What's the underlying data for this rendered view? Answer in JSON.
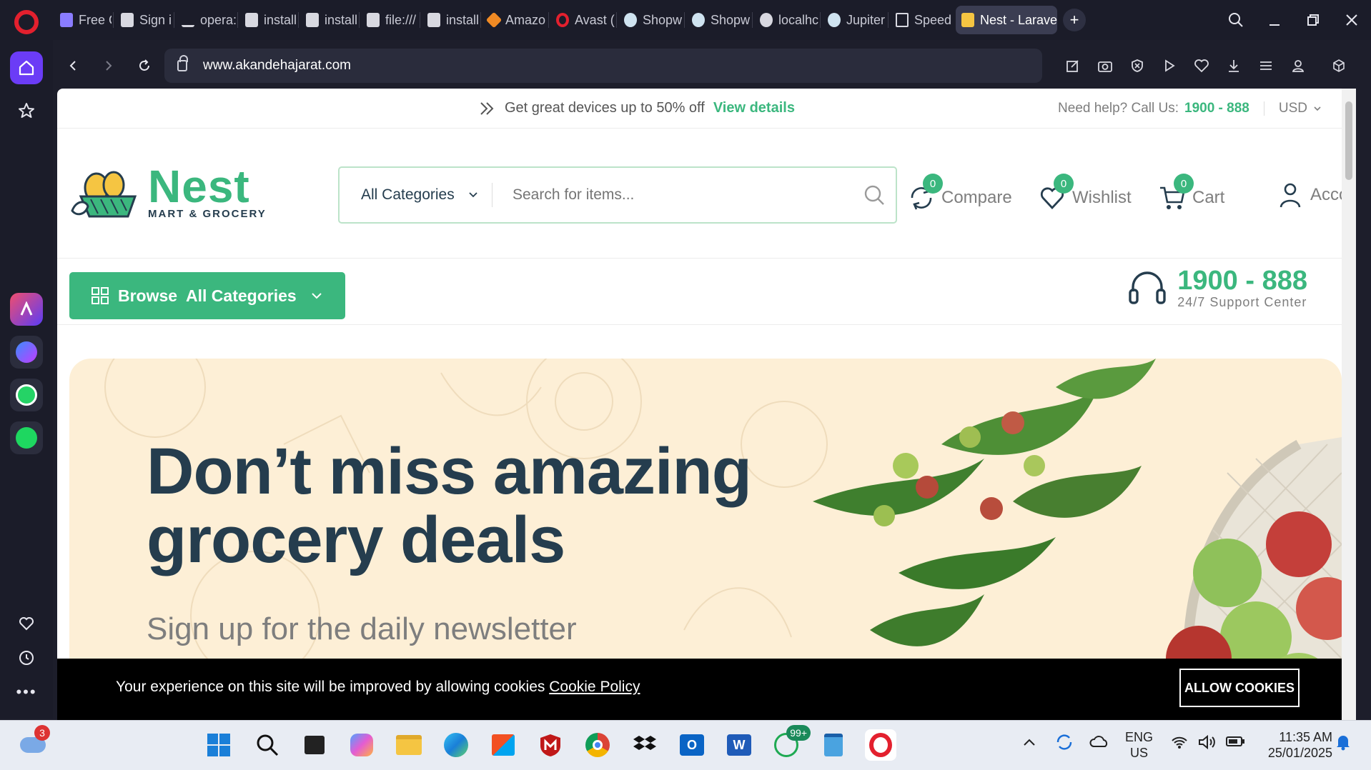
{
  "browser": {
    "tabs": [
      {
        "label": "Free Cl",
        "icon": "cube-icon"
      },
      {
        "label": "Sign in",
        "icon": "file-icon"
      },
      {
        "label": "opera:/",
        "icon": "download-icon"
      },
      {
        "label": "install",
        "icon": "file-icon"
      },
      {
        "label": "install",
        "icon": "file-icon"
      },
      {
        "label": "file:///",
        "icon": "file-icon"
      },
      {
        "label": "install",
        "icon": "file-icon"
      },
      {
        "label": "Amazo",
        "icon": "aws-icon"
      },
      {
        "label": "Avast (",
        "icon": "opera-icon"
      },
      {
        "label": "Shopw",
        "icon": "shop-icon"
      },
      {
        "label": "Shopw",
        "icon": "shop-icon"
      },
      {
        "label": "localhc",
        "icon": "globe-icon"
      },
      {
        "label": "Jupiter",
        "icon": "shop-icon"
      },
      {
        "label": "Speed",
        "icon": "grid-icon"
      },
      {
        "label": "Nest - Larave",
        "icon": "nest-icon"
      }
    ],
    "url": "www.akandehajarat.com"
  },
  "site": {
    "topbar": {
      "promo_text": "Get great devices up to 50% off",
      "promo_link": "View details",
      "help_text": "Need help? Call Us:",
      "help_phone": "1900 - 888",
      "currency": "USD"
    },
    "logo": {
      "name": "Nest",
      "tagline": "MART & GROCERY"
    },
    "search": {
      "category": "All Categories",
      "placeholder": "Search for items..."
    },
    "actions": {
      "compare": {
        "label": "Compare",
        "count": "0"
      },
      "wishlist": {
        "label": "Wishlist",
        "count": "0"
      },
      "cart": {
        "label": "Cart",
        "count": "0"
      },
      "account": {
        "label": "Account"
      }
    },
    "browse": {
      "label": "Browse  All Categories"
    },
    "support": {
      "phone": "1900 - 888",
      "label": "24/7 Support Center"
    },
    "hero": {
      "title_line1": "Don’t miss amazing",
      "title_line2": "grocery deals",
      "subtitle": "Sign up for the daily newsletter"
    },
    "cookie": {
      "message": "Your experience on this site will be improved by allowing cookies",
      "link": "Cookie Policy",
      "button": "ALLOW COOKIES"
    }
  },
  "taskbar": {
    "weather_badge": "3",
    "whatsapp_badge": "99+",
    "lang": "ENG",
    "region": "US",
    "time": "11:35 AM",
    "date": "25/01/2025"
  },
  "colors": {
    "brand_green": "#3bb77e",
    "dark_text": "#253d4e",
    "hero_bg": "#fdefd6",
    "browser_bg": "#1b1c29"
  }
}
